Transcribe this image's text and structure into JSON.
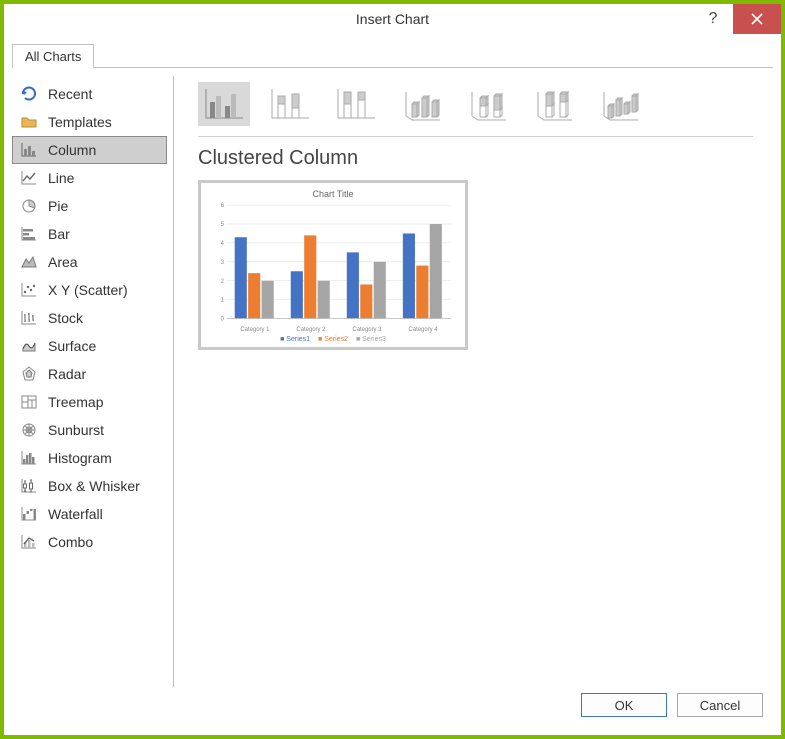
{
  "window": {
    "title": "Insert Chart"
  },
  "tabs": {
    "allCharts": "All Charts"
  },
  "sidebar": {
    "items": [
      {
        "label": "Recent",
        "selected": false
      },
      {
        "label": "Templates",
        "selected": false
      },
      {
        "label": "Column",
        "selected": true
      },
      {
        "label": "Line",
        "selected": false
      },
      {
        "label": "Pie",
        "selected": false
      },
      {
        "label": "Bar",
        "selected": false
      },
      {
        "label": "Area",
        "selected": false
      },
      {
        "label": "X Y (Scatter)",
        "selected": false
      },
      {
        "label": "Stock",
        "selected": false
      },
      {
        "label": "Surface",
        "selected": false
      },
      {
        "label": "Radar",
        "selected": false
      },
      {
        "label": "Treemap",
        "selected": false
      },
      {
        "label": "Sunburst",
        "selected": false
      },
      {
        "label": "Histogram",
        "selected": false
      },
      {
        "label": "Box & Whisker",
        "selected": false
      },
      {
        "label": "Waterfall",
        "selected": false
      },
      {
        "label": "Combo",
        "selected": false
      }
    ]
  },
  "subtypes": {
    "list": [
      {
        "name": "clustered-column",
        "selected": true
      },
      {
        "name": "stacked-column",
        "selected": false
      },
      {
        "name": "100-stacked-column",
        "selected": false
      },
      {
        "name": "3d-clustered-column",
        "selected": false
      },
      {
        "name": "3d-stacked-column",
        "selected": false
      },
      {
        "name": "3d-100-stacked-column",
        "selected": false
      },
      {
        "name": "3d-column",
        "selected": false
      }
    ]
  },
  "selectedChart": {
    "name": "Clustered Column"
  },
  "preview": {
    "title": "Chart Title",
    "legend": {
      "s1": "Series1",
      "s2": "Series2",
      "s3": "Series3"
    }
  },
  "buttons": {
    "ok": "OK",
    "cancel": "Cancel"
  },
  "chart_data": {
    "type": "bar",
    "title": "Chart Title",
    "categories": [
      "Category 1",
      "Category 2",
      "Category 3",
      "Category 4"
    ],
    "series": [
      {
        "name": "Series1",
        "values": [
          4.3,
          2.5,
          3.5,
          4.5
        ],
        "color": "#4472C4"
      },
      {
        "name": "Series2",
        "values": [
          2.4,
          4.4,
          1.8,
          2.8
        ],
        "color": "#ED7D31"
      },
      {
        "name": "Series3",
        "values": [
          2.0,
          2.0,
          3.0,
          5.0
        ],
        "color": "#A5A5A5"
      }
    ],
    "ylim": [
      0,
      6
    ],
    "yticks": [
      0,
      1,
      2,
      3,
      4,
      5,
      6
    ],
    "xlabel": "",
    "ylabel": ""
  }
}
